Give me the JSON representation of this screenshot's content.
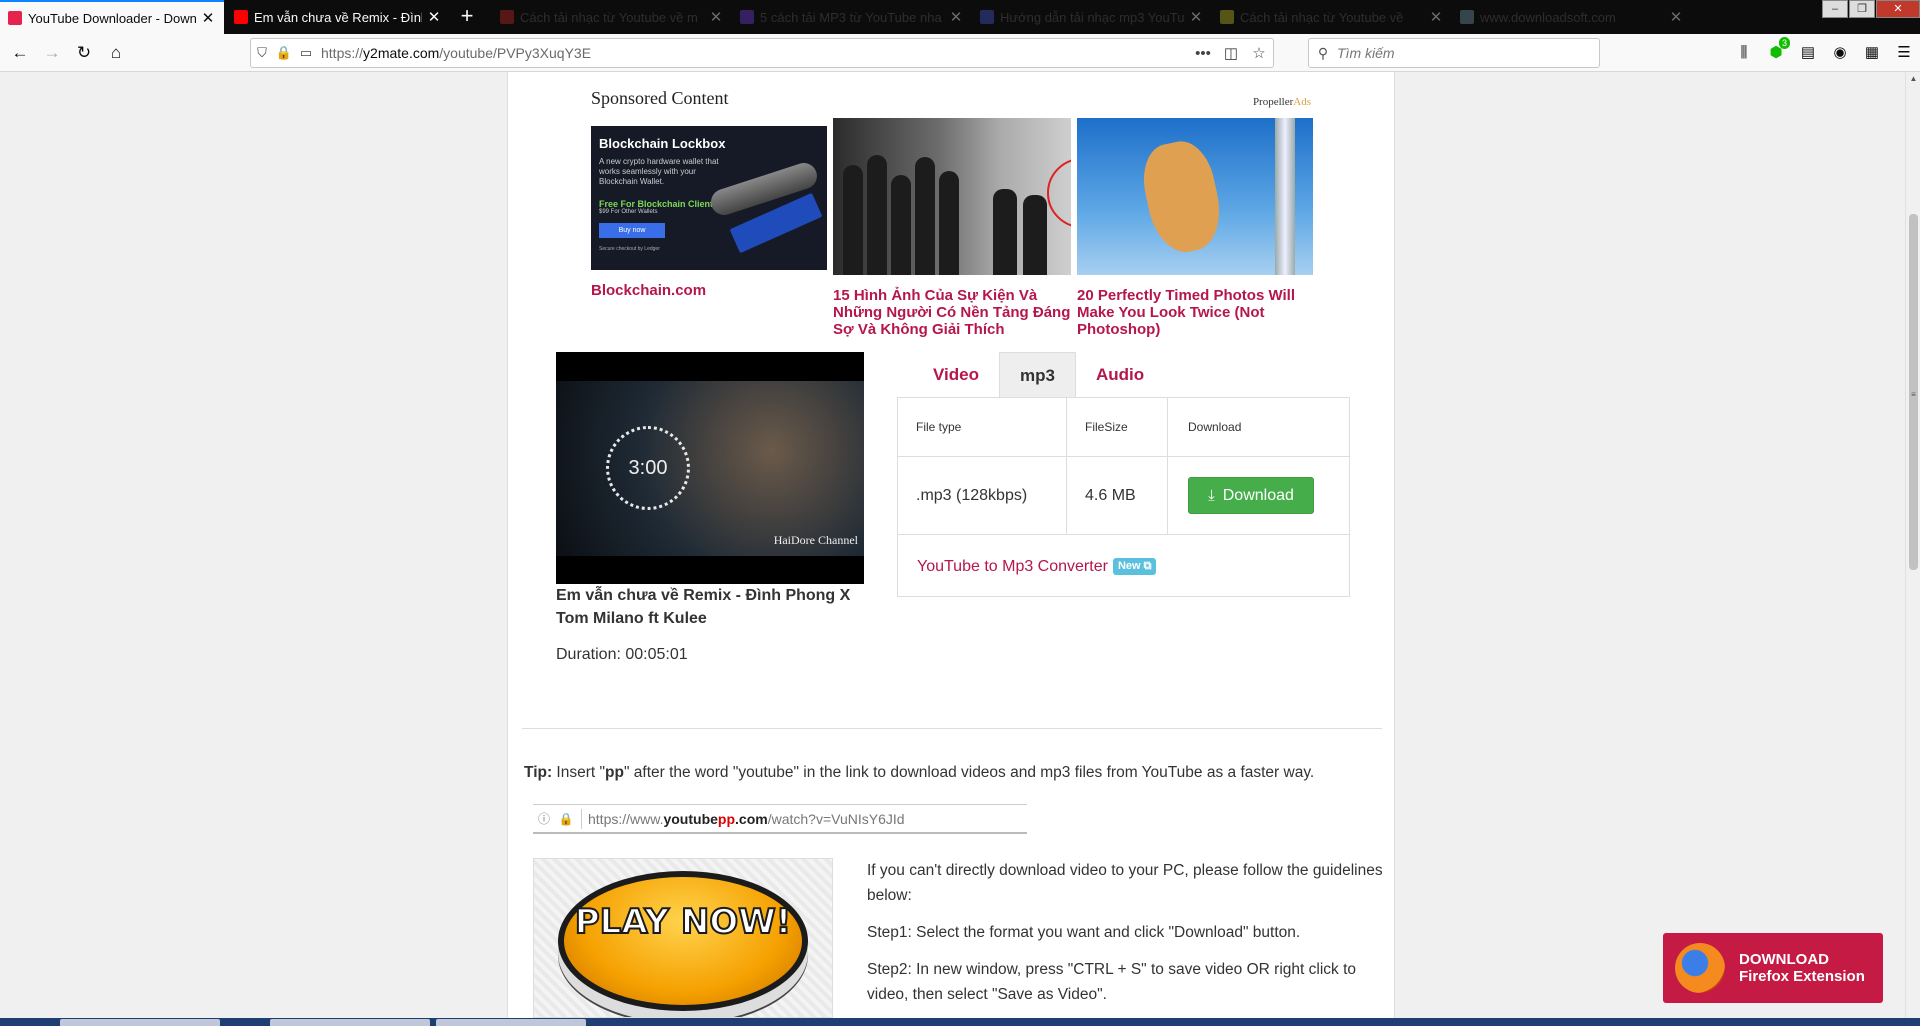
{
  "tabs": [
    {
      "title": "YouTube Downloader - Downlo",
      "favicon_color": "#e6234e",
      "active": true
    },
    {
      "title": "Em vẫn chưa về Remix - Đình P",
      "favicon_color": "#ff0000",
      "active": false
    },
    {
      "title": "Cách tải nhạc từ Youtube về m",
      "favicon_color": "#c62828",
      "active": false,
      "dim": true
    },
    {
      "title": "5 cách tải MP3 từ YouTube nha",
      "favicon_color": "#5e35b1",
      "active": false,
      "dim": true
    },
    {
      "title": "Hướng dẫn tải nhạc mp3 YouTu",
      "favicon_color": "#3949ab",
      "active": false,
      "dim": true
    },
    {
      "title": "Cách tải nhạc từ Youtube về",
      "favicon_color": "#9e9d24",
      "active": false,
      "dim": true
    },
    {
      "title": "www.downloadsoft.com",
      "favicon_color": "#607d8b",
      "active": false,
      "dim": true
    }
  ],
  "navbar": {
    "url_prefix": "https://",
    "url_host": "y2mate.com",
    "url_path": "/youtube/PVPy3XuqY3E",
    "search_placeholder": "Tìm kiếm",
    "addon_badge": "3"
  },
  "ads": {
    "heading": "Sponsored Content",
    "network_a": "Propeller",
    "network_b": "Ads",
    "items": [
      {
        "title": "Blockchain.com",
        "creative_headline": "Blockchain Lockbox",
        "creative_body": "A new crypto hardware wallet that works seamlessly with your Blockchain Wallet.",
        "creative_offer": "Free For Blockchain Clients",
        "creative_sub": "$99 For Other Wallets",
        "creative_button": "Buy now",
        "creative_footer": "Secure checkout by Ledger"
      },
      {
        "title": "15 Hình Ảnh Của Sự Kiện Và Những Người Có Nền Tảng Đáng Sợ Và Không Giải Thích"
      },
      {
        "title": "20 Perfectly Timed Photos Will Make You Look Twice (Not Photoshop)"
      }
    ]
  },
  "video": {
    "thumb_time": "3:00",
    "channel_watermark": "HaiDore Channel",
    "title": "Em vẫn chưa về Remix - Đình Phong X Tom Milano ft Kulee",
    "duration": "Duration: 00:05:01"
  },
  "format_tabs": [
    {
      "label": "Video",
      "active": false
    },
    {
      "label": "mp3",
      "active": true
    },
    {
      "label": "Audio",
      "active": false
    }
  ],
  "table": {
    "headers": [
      "File type",
      "FileSize",
      "Download"
    ],
    "rows": [
      {
        "type": ".mp3 (128kbps)",
        "size": "4.6 MB",
        "button": "Download"
      }
    ],
    "converter_link": "YouTube to Mp3 Converter",
    "new_tag": "New"
  },
  "tip": {
    "label": "Tip:",
    "text_a": " Insert \"",
    "keyword": "pp",
    "text_b": "\" after the word \"youtube\" in the link to download videos and mp3 files from YouTube as a faster way.",
    "sample_prefix": "https://www.",
    "sample_youtube": "youtube",
    "sample_pp": "pp",
    "sample_domain": ".com",
    "sample_path": "/watch?v=VuNIsY6JId"
  },
  "play_now_text": "PLAY NOW!",
  "guide": {
    "intro": "If you can't directly download video to your PC, please follow the guidelines below:",
    "step1": "Step1: Select the format you want and click \"Download\" button.",
    "step2": "Step2: In new window, press \"CTRL + S\" to save video OR right click to video, then select \"Save as Video\"."
  },
  "firefox_ext": {
    "line1": "DOWNLOAD",
    "line2": "Firefox Extension"
  },
  "colors": {
    "accent": "#b5174b",
    "download_green": "#45ad4a",
    "ext_red": "#c41a44",
    "new_tag": "#5bc0de"
  }
}
